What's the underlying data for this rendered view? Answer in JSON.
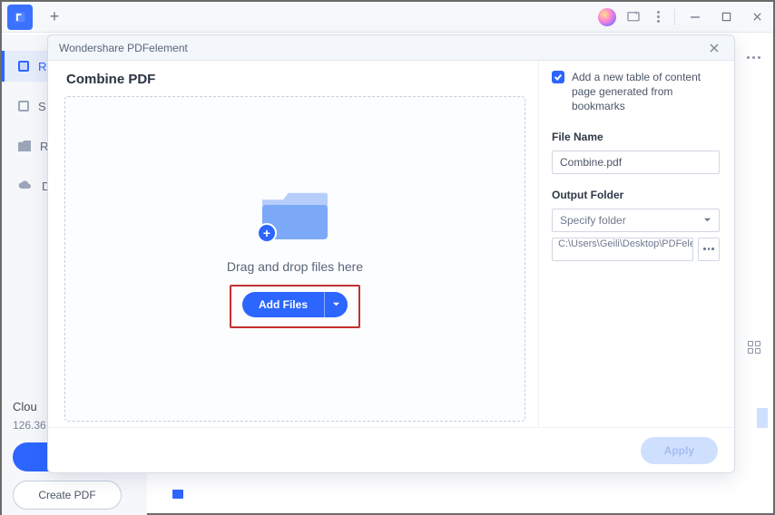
{
  "titlebar": {
    "title": "Wondershare PDFelement"
  },
  "sidebar": {
    "items": [
      {
        "label": "R"
      },
      {
        "label": "S"
      },
      {
        "label": "R"
      },
      {
        "label": "D"
      }
    ],
    "cloud_heading": "Clou",
    "cloud_size": "126.36",
    "create_pdf": "Create PDF"
  },
  "dialog": {
    "heading": "Combine PDF",
    "drop_text": "Drag and drop files here",
    "add_files": "Add Files",
    "option_toc": "Add a new table of content page generated from bookmarks",
    "filename_label": "File Name",
    "filename_value": "Combine.pdf",
    "outputfolder_label": "Output Folder",
    "outputfolder_select": "Specify folder",
    "outputfolder_path": "C:\\Users\\Geili\\Desktop\\PDFelement\\Cc",
    "apply": "Apply"
  }
}
